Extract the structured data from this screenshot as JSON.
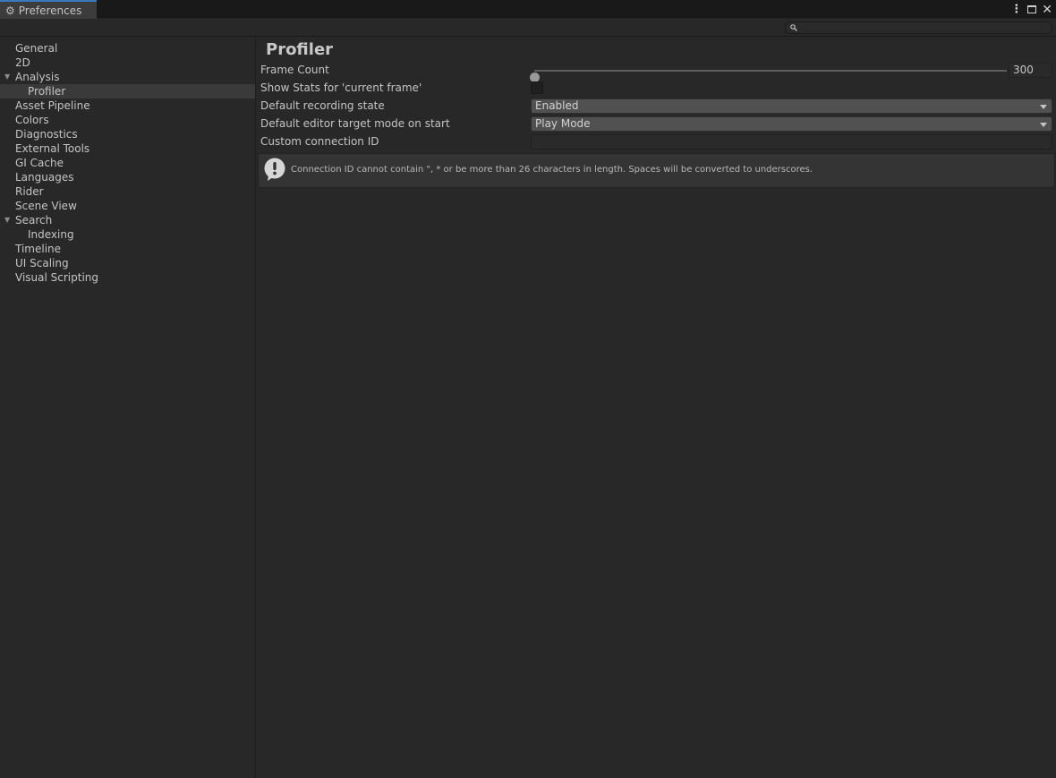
{
  "window": {
    "tab_title": "Preferences",
    "tab_icon": "gear-icon",
    "accent_color": "#3a79bb"
  },
  "toolbar": {
    "search_placeholder": "",
    "search_value": ""
  },
  "sidebar": {
    "items": [
      {
        "label": "General",
        "level": 0
      },
      {
        "label": "2D",
        "level": 0
      },
      {
        "label": "Analysis",
        "level": 0,
        "expanded": true
      },
      {
        "label": "Profiler",
        "level": 1,
        "selected": true
      },
      {
        "label": "Asset Pipeline",
        "level": 0
      },
      {
        "label": "Colors",
        "level": 0
      },
      {
        "label": "Diagnostics",
        "level": 0
      },
      {
        "label": "External Tools",
        "level": 0
      },
      {
        "label": "GI Cache",
        "level": 0
      },
      {
        "label": "Languages",
        "level": 0
      },
      {
        "label": "Rider",
        "level": 0
      },
      {
        "label": "Scene View",
        "level": 0
      },
      {
        "label": "Search",
        "level": 0,
        "expanded": true
      },
      {
        "label": "Indexing",
        "level": 1
      },
      {
        "label": "Timeline",
        "level": 0
      },
      {
        "label": "UI Scaling",
        "level": 0
      },
      {
        "label": "Visual Scripting",
        "level": 0
      }
    ]
  },
  "main": {
    "title": "Profiler",
    "frame_count": {
      "label": "Frame Count",
      "value": "300",
      "slider_fraction": 0.0
    },
    "show_stats": {
      "label": "Show Stats for 'current frame'",
      "checked": false
    },
    "recording_state": {
      "label": "Default recording state",
      "value": "Enabled"
    },
    "target_mode": {
      "label": "Default editor target mode on start",
      "value": "Play Mode"
    },
    "connection_id": {
      "label": "Custom connection ID",
      "value": ""
    },
    "help": {
      "icon": "warning-icon",
      "message": "Connection ID cannot contain \", * or be more than 26 characters in length. Spaces will be converted to underscores."
    }
  }
}
